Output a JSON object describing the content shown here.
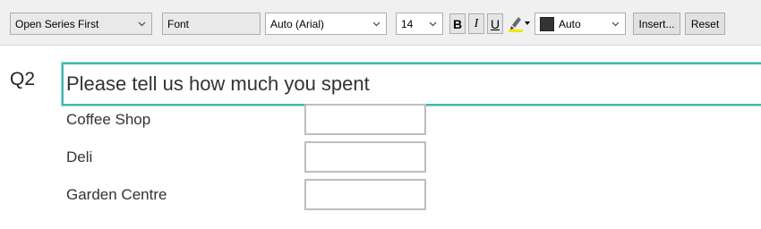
{
  "toolbar": {
    "series_select": "Open Series First",
    "font_select": "Font",
    "font_family": "Auto (Arial)",
    "font_size": "14",
    "bold_label": "B",
    "italic_label": "I",
    "underline_label": "U",
    "highlight_icon": "highlighter-icon",
    "color_label": "Auto",
    "color_value": "#333333",
    "insert_label": "Insert...",
    "reset_label": "Reset"
  },
  "question": {
    "number": "Q2",
    "text": "Please tell us how much you spent",
    "rows": [
      {
        "label": "Coffee Shop",
        "value": ""
      },
      {
        "label": "Deli",
        "value": ""
      },
      {
        "label": "Garden Centre",
        "value": ""
      }
    ]
  },
  "accent_color": "#40b8b0"
}
